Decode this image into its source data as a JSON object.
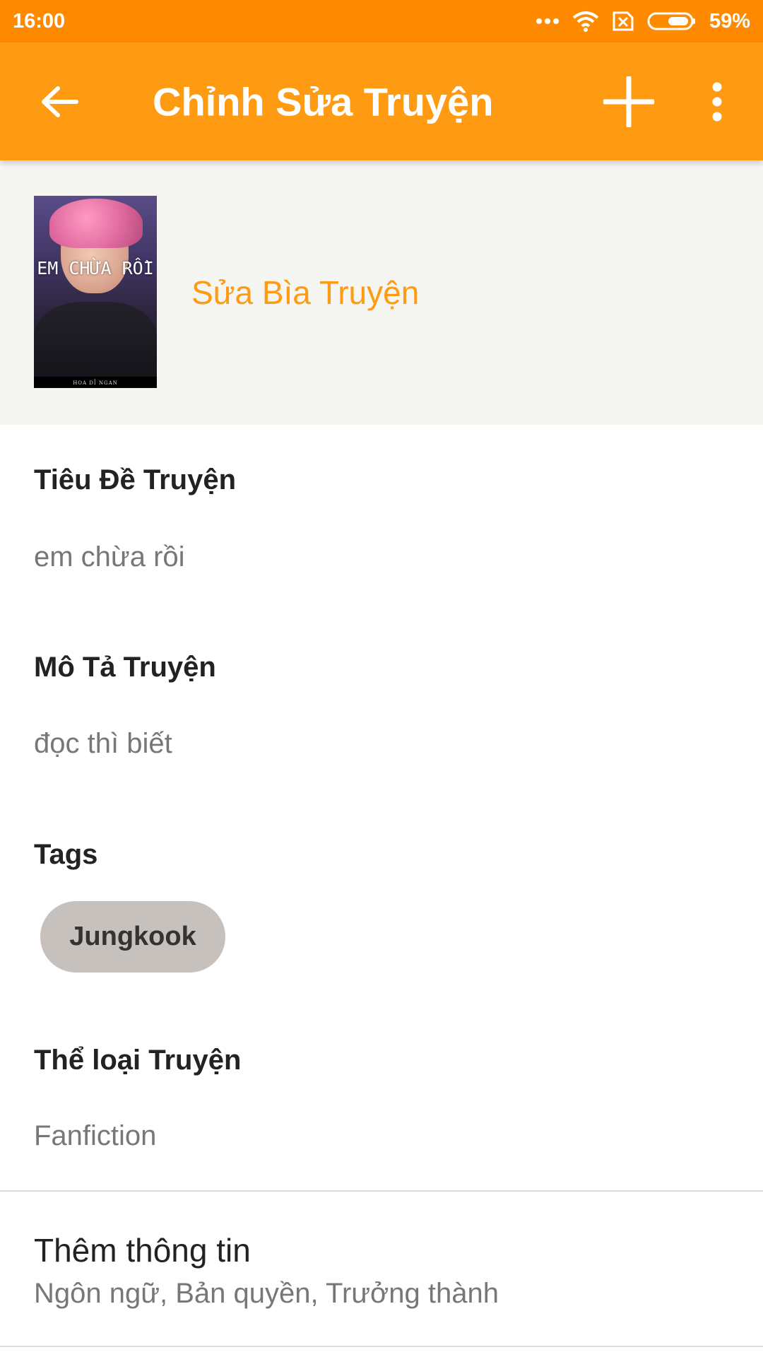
{
  "status_bar": {
    "time": "16:00",
    "battery": "59%",
    "icons": [
      "more-dots-icon",
      "wifi-icon",
      "no-sim-icon",
      "battery-icon"
    ]
  },
  "app_bar": {
    "title": "Chỉnh Sửa Truyện",
    "icons": [
      "back-arrow-icon",
      "plus-icon",
      "more-vert-icon"
    ],
    "background": "#ff9b13"
  },
  "cover": {
    "title_text": "EM CHỪA RỒI",
    "author_text": "HOA DỈ NGAN",
    "edit_cover_label": "Sửa Bìa Truyện"
  },
  "form": {
    "title_label": "Tiêu Đề Truyện",
    "title_value": "em chừa rồi",
    "description_label": "Mô Tả Truyện",
    "description_value": "đọc thì biết",
    "tags_label": "Tags",
    "tags": [
      "Jungkook"
    ],
    "genre_label": "Thể loại Truyện",
    "genre_value": "Fanfiction"
  },
  "more_info": {
    "title": "Thêm thông tin",
    "subtitle": "Ngôn ngữ, Bản quyền, Trưởng thành"
  },
  "colors": {
    "status_bar": "#ff8a00",
    "accent": "#ff9b13",
    "tag_chip": "#c7c1bd"
  }
}
